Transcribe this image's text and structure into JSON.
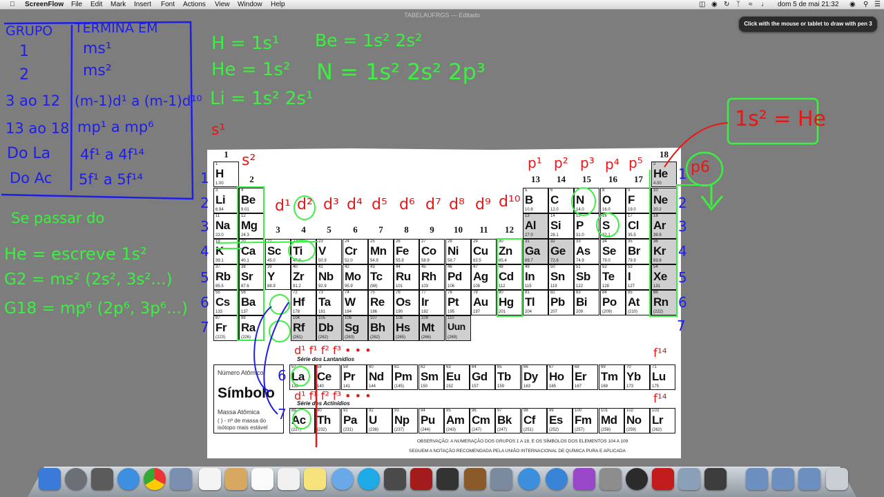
{
  "menubar": {
    "app": "ScreenFlow",
    "items": [
      "File",
      "Edit",
      "Mark",
      "Insert",
      "Font",
      "Actions",
      "View",
      "Window",
      "Help"
    ],
    "clock": "dom 5 de mai  21:32"
  },
  "window_title": "TABELAUFRGS — Editado",
  "tooltip": "Click with the mouse or tablet to draw with pen 3",
  "table": {
    "group_numbers": [
      "1",
      "2",
      "3",
      "4",
      "5",
      "6",
      "7",
      "8",
      "9",
      "10",
      "11",
      "12",
      "13",
      "14",
      "15",
      "16",
      "17",
      "18"
    ],
    "elements": [
      {
        "num": "1",
        "sym": "H",
        "mass": "1.00",
        "col": 1,
        "row": 1
      },
      {
        "num": "2",
        "sym": "He",
        "mass": "4.00",
        "col": 18,
        "row": 1,
        "gray": true
      },
      {
        "num": "3",
        "sym": "Li",
        "mass": "6.94",
        "col": 1,
        "row": 2
      },
      {
        "num": "4",
        "sym": "Be",
        "mass": "9.01",
        "col": 2,
        "row": 2
      },
      {
        "num": "5",
        "sym": "B",
        "mass": "10.8",
        "col": 13,
        "row": 2
      },
      {
        "num": "6",
        "sym": "C",
        "mass": "12.0",
        "col": 14,
        "row": 2
      },
      {
        "num": "7",
        "sym": "N",
        "mass": "14.0",
        "col": 15,
        "row": 2
      },
      {
        "num": "8",
        "sym": "O",
        "mass": "16.0",
        "col": 16,
        "row": 2
      },
      {
        "num": "9",
        "sym": "F",
        "mass": "19.0",
        "col": 17,
        "row": 2
      },
      {
        "num": "10",
        "sym": "Ne",
        "mass": "20.2",
        "col": 18,
        "row": 2,
        "gray": true
      },
      {
        "num": "11",
        "sym": "Na",
        "mass": "23.0",
        "col": 1,
        "row": 3
      },
      {
        "num": "12",
        "sym": "Mg",
        "mass": "24.3",
        "col": 2,
        "row": 3
      },
      {
        "num": "13",
        "sym": "Al",
        "mass": "27.0",
        "col": 13,
        "row": 3,
        "gray": true
      },
      {
        "num": "14",
        "sym": "Si",
        "mass": "28.1",
        "col": 14,
        "row": 3
      },
      {
        "num": "15",
        "sym": "P",
        "mass": "31.0",
        "col": 15,
        "row": 3
      },
      {
        "num": "16",
        "sym": "S",
        "mass": "32.1",
        "col": 16,
        "row": 3
      },
      {
        "num": "17",
        "sym": "Cl",
        "mass": "35.5",
        "col": 17,
        "row": 3
      },
      {
        "num": "18",
        "sym": "Ar",
        "mass": "39.9",
        "col": 18,
        "row": 3,
        "gray": true
      },
      {
        "num": "19",
        "sym": "K",
        "mass": "39.1",
        "col": 1,
        "row": 4
      },
      {
        "num": "20",
        "sym": "Ca",
        "mass": "40.1",
        "col": 2,
        "row": 4
      },
      {
        "num": "21",
        "sym": "Sc",
        "mass": "45.0",
        "col": 3,
        "row": 4
      },
      {
        "num": "22",
        "sym": "Ti",
        "mass": "47.9",
        "col": 4,
        "row": 4
      },
      {
        "num": "23",
        "sym": "V",
        "mass": "50.9",
        "col": 5,
        "row": 4
      },
      {
        "num": "24",
        "sym": "Cr",
        "mass": "52.0",
        "col": 6,
        "row": 4
      },
      {
        "num": "25",
        "sym": "Mn",
        "mass": "54.9",
        "col": 7,
        "row": 4
      },
      {
        "num": "26",
        "sym": "Fe",
        "mass": "55.8",
        "col": 8,
        "row": 4
      },
      {
        "num": "27",
        "sym": "Co",
        "mass": "58.9",
        "col": 9,
        "row": 4
      },
      {
        "num": "28",
        "sym": "Ni",
        "mass": "58.7",
        "col": 10,
        "row": 4
      },
      {
        "num": "29",
        "sym": "Cu",
        "mass": "63.5",
        "col": 11,
        "row": 4
      },
      {
        "num": "30",
        "sym": "Zn",
        "mass": "65.4",
        "col": 12,
        "row": 4
      },
      {
        "num": "31",
        "sym": "Ga",
        "mass": "69.7",
        "col": 13,
        "row": 4,
        "gray": true
      },
      {
        "num": "32",
        "sym": "Ge",
        "mass": "72.6",
        "col": 14,
        "row": 4,
        "gray": true
      },
      {
        "num": "33",
        "sym": "As",
        "mass": "74.9",
        "col": 15,
        "row": 4
      },
      {
        "num": "34",
        "sym": "Se",
        "mass": "79.0",
        "col": 16,
        "row": 4
      },
      {
        "num": "35",
        "sym": "Br",
        "mass": "79.9",
        "col": 17,
        "row": 4
      },
      {
        "num": "36",
        "sym": "Kr",
        "mass": "83.8",
        "col": 18,
        "row": 4,
        "gray": true
      },
      {
        "num": "37",
        "sym": "Rb",
        "mass": "85.5",
        "col": 1,
        "row": 5
      },
      {
        "num": "38",
        "sym": "Sr",
        "mass": "87.6",
        "col": 2,
        "row": 5
      },
      {
        "num": "39",
        "sym": "Y",
        "mass": "88.9",
        "col": 3,
        "row": 5
      },
      {
        "num": "40",
        "sym": "Zr",
        "mass": "91.2",
        "col": 4,
        "row": 5
      },
      {
        "num": "41",
        "sym": "Nb",
        "mass": "92.9",
        "col": 5,
        "row": 5
      },
      {
        "num": "42",
        "sym": "Mo",
        "mass": "95.9",
        "col": 6,
        "row": 5
      },
      {
        "num": "43",
        "sym": "Tc",
        "mass": "(98)",
        "col": 7,
        "row": 5
      },
      {
        "num": "44",
        "sym": "Ru",
        "mass": "101",
        "col": 8,
        "row": 5
      },
      {
        "num": "45",
        "sym": "Rh",
        "mass": "103",
        "col": 9,
        "row": 5
      },
      {
        "num": "46",
        "sym": "Pd",
        "mass": "106",
        "col": 10,
        "row": 5
      },
      {
        "num": "47",
        "sym": "Ag",
        "mass": "108",
        "col": 11,
        "row": 5
      },
      {
        "num": "48",
        "sym": "Cd",
        "mass": "112",
        "col": 12,
        "row": 5
      },
      {
        "num": "49",
        "sym": "In",
        "mass": "115",
        "col": 13,
        "row": 5
      },
      {
        "num": "50",
        "sym": "Sn",
        "mass": "119",
        "col": 14,
        "row": 5
      },
      {
        "num": "51",
        "sym": "Sb",
        "mass": "122",
        "col": 15,
        "row": 5
      },
      {
        "num": "52",
        "sym": "Te",
        "mass": "128",
        "col": 16,
        "row": 5
      },
      {
        "num": "53",
        "sym": "I",
        "mass": "127",
        "col": 17,
        "row": 5
      },
      {
        "num": "54",
        "sym": "Xe",
        "mass": "131",
        "col": 18,
        "row": 5,
        "gray": true
      },
      {
        "num": "55",
        "sym": "Cs",
        "mass": "133",
        "col": 1,
        "row": 6
      },
      {
        "num": "56",
        "sym": "Ba",
        "mass": "137",
        "col": 2,
        "row": 6
      },
      {
        "num": "72",
        "sym": "Hf",
        "mass": "178",
        "col": 4,
        "row": 6
      },
      {
        "num": "73",
        "sym": "Ta",
        "mass": "181",
        "col": 5,
        "row": 6
      },
      {
        "num": "74",
        "sym": "W",
        "mass": "184",
        "col": 6,
        "row": 6
      },
      {
        "num": "75",
        "sym": "Re",
        "mass": "186",
        "col": 7,
        "row": 6
      },
      {
        "num": "76",
        "sym": "Os",
        "mass": "190",
        "col": 8,
        "row": 6
      },
      {
        "num": "77",
        "sym": "Ir",
        "mass": "192",
        "col": 9,
        "row": 6
      },
      {
        "num": "78",
        "sym": "Pt",
        "mass": "195",
        "col": 10,
        "row": 6
      },
      {
        "num": "79",
        "sym": "Au",
        "mass": "197",
        "col": 11,
        "row": 6
      },
      {
        "num": "80",
        "sym": "Hg",
        "mass": "201",
        "col": 12,
        "row": 6
      },
      {
        "num": "81",
        "sym": "Tl",
        "mass": "204",
        "col": 13,
        "row": 6
      },
      {
        "num": "82",
        "sym": "Pb",
        "mass": "207",
        "col": 14,
        "row": 6
      },
      {
        "num": "83",
        "sym": "Bi",
        "mass": "209",
        "col": 15,
        "row": 6
      },
      {
        "num": "84",
        "sym": "Po",
        "mass": "(209)",
        "col": 16,
        "row": 6
      },
      {
        "num": "85",
        "sym": "At",
        "mass": "(210)",
        "col": 17,
        "row": 6
      },
      {
        "num": "86",
        "sym": "Rn",
        "mass": "(222)",
        "col": 18,
        "row": 6,
        "gray": true
      },
      {
        "num": "87",
        "sym": "Fr",
        "mass": "(223)",
        "col": 1,
        "row": 7
      },
      {
        "num": "88",
        "sym": "Ra",
        "mass": "(226)",
        "col": 2,
        "row": 7
      },
      {
        "num": "104",
        "sym": "Rf",
        "mass": "(261)",
        "col": 4,
        "row": 7,
        "gray": true
      },
      {
        "num": "105",
        "sym": "Db",
        "mass": "(262)",
        "col": 5,
        "row": 7,
        "gray": true
      },
      {
        "num": "106",
        "sym": "Sg",
        "mass": "(263)",
        "col": 6,
        "row": 7,
        "gray": true
      },
      {
        "num": "107",
        "sym": "Bh",
        "mass": "(262)",
        "col": 7,
        "row": 7,
        "gray": true
      },
      {
        "num": "108",
        "sym": "Hs",
        "mass": "(265)",
        "col": 8,
        "row": 7,
        "gray": true
      },
      {
        "num": "109",
        "sym": "Mt",
        "mass": "(266)",
        "col": 9,
        "row": 7,
        "gray": true
      },
      {
        "num": "110",
        "sym": "Uun",
        "mass": "(269)",
        "col": 10,
        "row": 7,
        "gray": true
      },
      {
        "num": "57",
        "sym": "La",
        "mass": "139",
        "col": 1,
        "row": 9
      },
      {
        "num": "58",
        "sym": "Ce",
        "mass": "140",
        "col": 2,
        "row": 9
      },
      {
        "num": "59",
        "sym": "Pr",
        "mass": "141",
        "col": 3,
        "row": 9
      },
      {
        "num": "60",
        "sym": "Nd",
        "mass": "144",
        "col": 4,
        "row": 9
      },
      {
        "num": "61",
        "sym": "Pm",
        "mass": "(145)",
        "col": 5,
        "row": 9
      },
      {
        "num": "62",
        "sym": "Sm",
        "mass": "150",
        "col": 6,
        "row": 9
      },
      {
        "num": "63",
        "sym": "Eu",
        "mass": "152",
        "col": 7,
        "row": 9
      },
      {
        "num": "64",
        "sym": "Gd",
        "mass": "157",
        "col": 8,
        "row": 9
      },
      {
        "num": "65",
        "sym": "Tb",
        "mass": "159",
        "col": 9,
        "row": 9
      },
      {
        "num": "66",
        "sym": "Dy",
        "mass": "163",
        "col": 10,
        "row": 9
      },
      {
        "num": "67",
        "sym": "Ho",
        "mass": "165",
        "col": 11,
        "row": 9
      },
      {
        "num": "68",
        "sym": "Er",
        "mass": "167",
        "col": 12,
        "row": 9
      },
      {
        "num": "69",
        "sym": "Tm",
        "mass": "169",
        "col": 13,
        "row": 9
      },
      {
        "num": "70",
        "sym": "Yb",
        "mass": "173",
        "col": 14,
        "row": 9
      },
      {
        "num": "71",
        "sym": "Lu",
        "mass": "175",
        "col": 15,
        "row": 9
      },
      {
        "num": "89",
        "sym": "Ac",
        "mass": "(227)",
        "col": 1,
        "row": 10
      },
      {
        "num": "90",
        "sym": "Th",
        "mass": "(232)",
        "col": 2,
        "row": 10
      },
      {
        "num": "91",
        "sym": "Pa",
        "mass": "(231)",
        "col": 3,
        "row": 10
      },
      {
        "num": "92",
        "sym": "U",
        "mass": "(238)",
        "col": 4,
        "row": 10
      },
      {
        "num": "93",
        "sym": "Np",
        "mass": "(237)",
        "col": 5,
        "row": 10
      },
      {
        "num": "94",
        "sym": "Pu",
        "mass": "(244)",
        "col": 6,
        "row": 10
      },
      {
        "num": "95",
        "sym": "Am",
        "mass": "(243)",
        "col": 7,
        "row": 10
      },
      {
        "num": "96",
        "sym": "Cm",
        "mass": "(247)",
        "col": 8,
        "row": 10
      },
      {
        "num": "97",
        "sym": "Bk",
        "mass": "(247)",
        "col": 9,
        "row": 10
      },
      {
        "num": "98",
        "sym": "Cf",
        "mass": "(251)",
        "col": 10,
        "row": 10
      },
      {
        "num": "99",
        "sym": "Es",
        "mass": "(252)",
        "col": 11,
        "row": 10
      },
      {
        "num": "100",
        "sym": "Fm",
        "mass": "(257)",
        "col": 12,
        "row": 10
      },
      {
        "num": "101",
        "sym": "Md",
        "mass": "(258)",
        "col": 13,
        "row": 10
      },
      {
        "num": "102",
        "sym": "No",
        "mass": "(259)",
        "col": 14,
        "row": 10
      },
      {
        "num": "103",
        "sym": "Lr",
        "mass": "(262)",
        "col": 15,
        "row": 10
      }
    ],
    "lanthanide_caption": "Série dos Lantanídios",
    "actinide_caption": "Série dos Actinídios",
    "legend": {
      "number": "Número Atômico",
      "symbol": "Símbolo",
      "mass": "Massa Atômica",
      "note": "( ) - nº de massa do isótopo mais estável"
    },
    "observation_line1": "OBSERVAÇÃO: A NUMERAÇÃO DOS GRUPOS 1 A 18, E OS SÍMBOLOS DOS ELEMENTOS 104 A 109",
    "observation_line2": "SEGUEM A NOTAÇÃO RECOMENDADA PELA UNIÃO INTERNACIONAL DE QUÍMICA PURA E APLICADA"
  },
  "handwriting": {
    "blue_table": {
      "header_left": "GRUPO",
      "header_right": "TERMINA EM",
      "rows": [
        [
          "1",
          "ms¹"
        ],
        [
          "2",
          "ms²"
        ],
        [
          "3 ao 12",
          "(m-1)d¹ a (m-1)d¹⁰"
        ],
        [
          "13 ao 18",
          "mp¹ a mp⁶"
        ],
        [
          "Do La",
          "4f¹ a 4f¹⁴"
        ],
        [
          "Do Ac",
          "5f¹ a 5f¹⁴"
        ]
      ]
    },
    "green_left": [
      "Se passar do",
      "He = escreve 1s²",
      "G2 = ms² (2s², 3s²...)",
      "G18 = mp⁶ (2p⁶, 3p⁶...)"
    ],
    "green_top": [
      "H = 1s¹",
      "He = 1s²",
      "Li = 1s² 2s¹",
      "Be = 1s² 2s²",
      "N = 1s² 2s² 2p³"
    ],
    "red_s1": "s¹",
    "red_s2": "s²",
    "red_d": [
      "d¹",
      "d²",
      "d³",
      "d⁴",
      "d⁵",
      "d⁶",
      "d⁷",
      "d⁸",
      "d⁹",
      "d¹⁰"
    ],
    "red_p": [
      "p¹",
      "p²",
      "p³",
      "p⁴",
      "p⁵"
    ],
    "red_p6": "p6",
    "red_1s2_he": "1s² = He",
    "red_f_lan": "d¹ f¹ f² f³ • • •",
    "red_f_act": "d¹ f¹ f² f³ • • •",
    "red_f14": "f¹⁴",
    "blue_periods": [
      "1",
      "2",
      "3",
      "4",
      "5",
      "6",
      "7"
    ],
    "blue_6": "6",
    "blue_7": "7"
  },
  "colors": {
    "blue": "#1e1ee6",
    "green": "#3bf040",
    "red": "#e81616",
    "gray_cell": "#cfcfcf"
  }
}
